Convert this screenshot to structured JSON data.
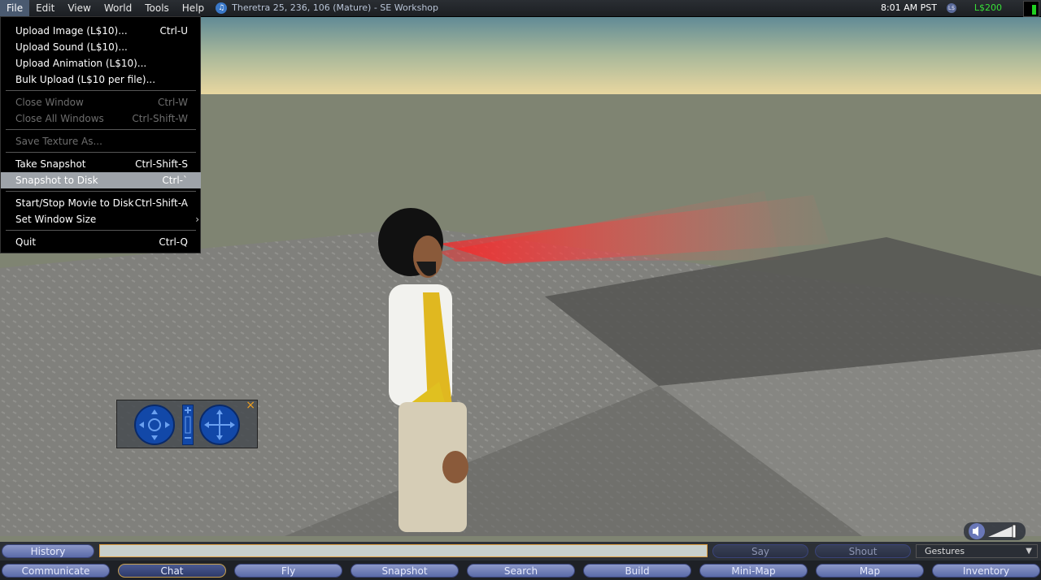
{
  "menubar": {
    "items": [
      "File",
      "Edit",
      "View",
      "World",
      "Tools",
      "Help"
    ],
    "location": "Theretra 25, 236, 106 (Mature) - SE Workshop",
    "time": "8:01 AM PST",
    "currency_icon": "L$",
    "balance": "L$200"
  },
  "file_menu": {
    "items": [
      {
        "label": "Upload Image (L$10)...",
        "shortcut": "Ctrl-U",
        "state": "enabled"
      },
      {
        "label": "Upload Sound (L$10)...",
        "shortcut": "",
        "state": "enabled"
      },
      {
        "label": "Upload Animation (L$10)...",
        "shortcut": "",
        "state": "enabled"
      },
      {
        "label": "Bulk Upload (L$10 per file)...",
        "shortcut": "",
        "state": "enabled"
      },
      {
        "label": "Close Window",
        "shortcut": "Ctrl-W",
        "state": "disabled"
      },
      {
        "label": "Close All Windows",
        "shortcut": "Ctrl-Shift-W",
        "state": "disabled"
      },
      {
        "label": "Save Texture As...",
        "shortcut": "",
        "state": "disabled"
      },
      {
        "label": "Take Snapshot",
        "shortcut": "Ctrl-Shift-S",
        "state": "enabled"
      },
      {
        "label": "Snapshot to Disk",
        "shortcut": "Ctrl-`",
        "state": "highlighted"
      },
      {
        "label": "Start/Stop Movie to Disk",
        "shortcut": "Ctrl-Shift-A",
        "state": "enabled"
      },
      {
        "label": "Set Window Size",
        "shortcut": "",
        "state": "enabled",
        "submenu": true
      },
      {
        "label": "Quit",
        "shortcut": "Ctrl-Q",
        "state": "enabled"
      }
    ]
  },
  "chatbar": {
    "history": "History",
    "say": "Say",
    "shout": "Shout",
    "gestures": "Gestures"
  },
  "toolbar": {
    "buttons": [
      "Communicate",
      "Chat",
      "Fly",
      "Snapshot",
      "Search",
      "Build",
      "Mini-Map",
      "Map",
      "Inventory"
    ]
  },
  "colors": {
    "accent_orange": "#e0a040",
    "balance_green": "#38e038",
    "pill_blue": "#6a78b8"
  }
}
